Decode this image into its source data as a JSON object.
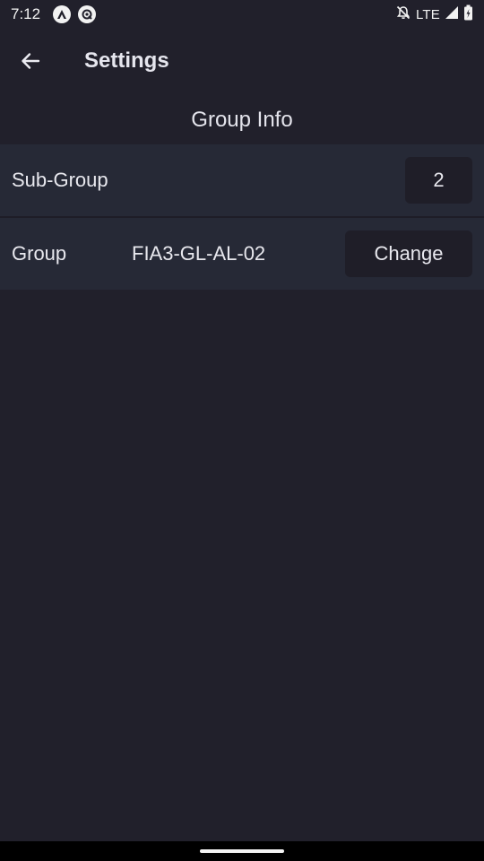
{
  "status_bar": {
    "time": "7:12",
    "network": "LTE",
    "icons": [
      "app-icon-a",
      "app-icon-at",
      "notifications-off-icon",
      "signal-icon",
      "battery-icon"
    ]
  },
  "app_bar": {
    "title": "Settings",
    "back_icon": "arrow-left-icon"
  },
  "section": {
    "title": "Group Info"
  },
  "rows": {
    "sub_group": {
      "label": "Sub-Group",
      "value": "2"
    },
    "group": {
      "label": "Group",
      "value": "FIA3-GL-AL-02",
      "button_label": "Change"
    }
  },
  "colors": {
    "background": "#21202b",
    "row_background": "#262936",
    "box_background": "#1f1e28",
    "text": "#e8e8ee"
  }
}
